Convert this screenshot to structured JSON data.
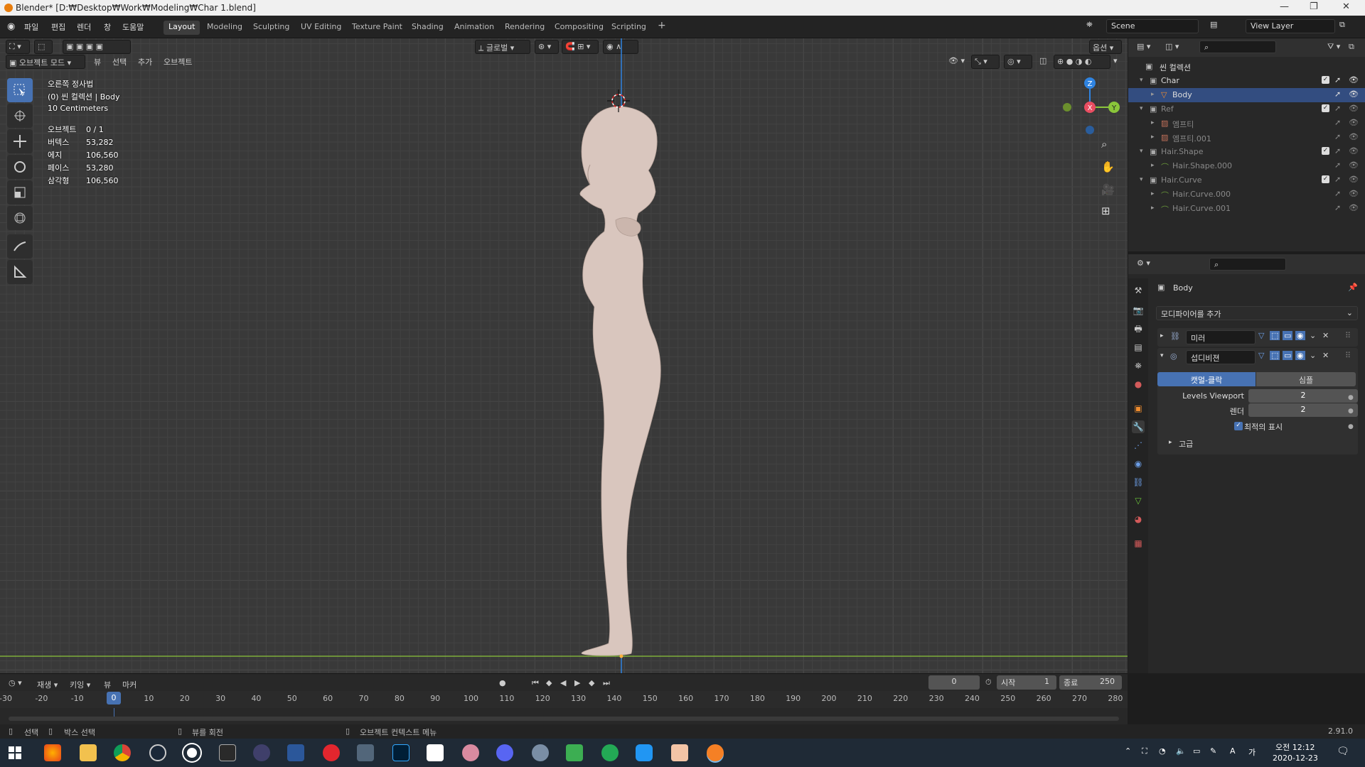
{
  "window": {
    "title": "Blender* [D:₩Desktop₩Work₩Modeling₩Char 1.blend]"
  },
  "topbar": {
    "menus": [
      "파일",
      "편집",
      "렌더",
      "창",
      "도움말"
    ],
    "workspaces": [
      "Layout",
      "Modeling",
      "Sculpting",
      "UV Editing",
      "Texture Paint",
      "Shading",
      "Animation",
      "Rendering",
      "Compositing",
      "Scripting"
    ],
    "active_workspace": "Layout",
    "add_tab": "+",
    "scene": "Scene",
    "view_layer": "View Layer"
  },
  "viewport": {
    "mode": "오브젝트 모드",
    "menus": [
      "뷰",
      "선택",
      "추가",
      "오브젝트"
    ],
    "transform_orientation": "글로벌",
    "options_label": "옵션",
    "overlay_title": "오른쪽 정사법",
    "overlay_collection": "(0) 씬 컬렉션 | Body",
    "overlay_scale": "10 Centimeters",
    "stats": [
      {
        "label": "오브젝트",
        "value": "0 / 1"
      },
      {
        "label": "버텍스",
        "value": "53,282"
      },
      {
        "label": "에지",
        "value": "106,560"
      },
      {
        "label": "페이스",
        "value": "53,280"
      },
      {
        "label": "삼각형",
        "value": "106,560"
      }
    ],
    "gizmo": {
      "z": "Z",
      "x": "X",
      "y": "Y"
    }
  },
  "outliner": {
    "root": "씬 컬렉션",
    "rows": [
      {
        "name": "Char",
        "level": 1,
        "type": "collection",
        "dim": false
      },
      {
        "name": "Body",
        "level": 2,
        "type": "mesh",
        "dim": false
      },
      {
        "name": "Ref",
        "level": 1,
        "type": "collection",
        "dim": true
      },
      {
        "name": "엠프티",
        "level": 2,
        "type": "image",
        "dim": true
      },
      {
        "name": "엠프티.001",
        "level": 2,
        "type": "image",
        "dim": true
      },
      {
        "name": "Hair.Shape",
        "level": 1,
        "type": "collection",
        "dim": true
      },
      {
        "name": "Hair.Shape.000",
        "level": 2,
        "type": "curve",
        "dim": true
      },
      {
        "name": "Hair.Curve",
        "level": 1,
        "type": "collection",
        "dim": true
      },
      {
        "name": "Hair.Curve.000",
        "level": 2,
        "type": "curve",
        "dim": true
      },
      {
        "name": "Hair.Curve.001",
        "level": 2,
        "type": "curve",
        "dim": true
      }
    ]
  },
  "properties": {
    "object_name": "Body",
    "add_modifier": "모디파이어를 추가",
    "modifiers": [
      {
        "name": "미러",
        "expanded": false
      },
      {
        "name": "섭디비젼",
        "expanded": true
      }
    ],
    "subdiv": {
      "tab_catmull": "캣멀-클락",
      "tab_simple": "심플",
      "levels_viewport_label": "Levels Viewport",
      "levels_viewport": "2",
      "render_label": "렌더",
      "render": "2",
      "optimal_label": "최적의 표시",
      "advanced_label": "고급"
    }
  },
  "timeline": {
    "menus": [
      "재생",
      "키잉",
      "뷰",
      "마커"
    ],
    "current_frame": "0",
    "start_label": "시작",
    "start": "1",
    "end_label": "종료",
    "end": "250",
    "ticks": [
      "-30",
      "-20",
      "-10",
      "0",
      "10",
      "20",
      "30",
      "40",
      "50",
      "60",
      "70",
      "80",
      "90",
      "100",
      "110",
      "120",
      "130",
      "140",
      "150",
      "160",
      "170",
      "180",
      "190",
      "200",
      "210",
      "220",
      "230",
      "240",
      "250",
      "260",
      "270",
      "280"
    ]
  },
  "statusbar": {
    "select": "선택",
    "box_select": "박스 선택",
    "rotate_view": "뷰를 회전",
    "context_menu": "오브젝트 컨텍스트 메뉴",
    "version": "2.91.0"
  },
  "taskbar": {
    "time": "오전 12:12",
    "date": "2020-12-23",
    "ime": "A",
    "ime2": "가"
  },
  "colors": {
    "accent": "#4772b3",
    "axis_x": "#e94d61",
    "axis_y": "#8ac53a",
    "axis_z": "#2f83e0",
    "body": "#d9c6be"
  }
}
